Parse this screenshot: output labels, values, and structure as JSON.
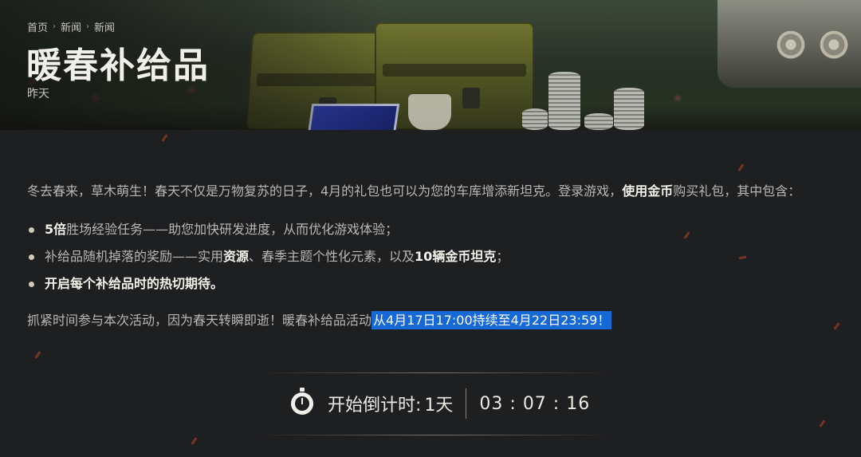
{
  "breadcrumb": {
    "items": [
      "首页",
      "新闻",
      "新闻"
    ],
    "separator": "›"
  },
  "header": {
    "title": "暖春补给品",
    "date": "昨天"
  },
  "article": {
    "intro": {
      "part1": "冬去春来，草木萌生！春天不仅是万物复苏的日子，4月的礼包也可以为您的车库增添新坦克。登录游戏，",
      "highlight": "使用金币",
      "part2": "购买礼包，其中包含："
    },
    "bullets": [
      {
        "strong": "5倍",
        "rest": "胜场经验任务——助您加快研发进度，从而优化游戏体验；"
      },
      {
        "pre": "补给品随机掉落的奖励——实用",
        "strong1": "资源",
        "mid": "、春季主题个性化元素，以及",
        "strong2": "10辆金币坦克",
        "end": "；"
      },
      {
        "text": "开启每个补给品时的热切期待。"
      }
    ],
    "closing": {
      "text": "抓紧时间参与本次活动，因为春天转瞬即逝！暖春补给品活动",
      "selected": "从4月17日17:00持续至4月22日23:59！"
    }
  },
  "countdown": {
    "label": "开始倒计时:",
    "days": "1天",
    "time": "03 : 07 : 16"
  },
  "colors": {
    "background": "#1e1f21",
    "selection": "#1668d6",
    "text": "#b9b7b2",
    "highlight": "#f3f1ea"
  },
  "icons": {
    "countdown": "stopwatch-icon",
    "breadcrumb_separator": "chevron-right-icon",
    "bullet": "dot-icon"
  }
}
